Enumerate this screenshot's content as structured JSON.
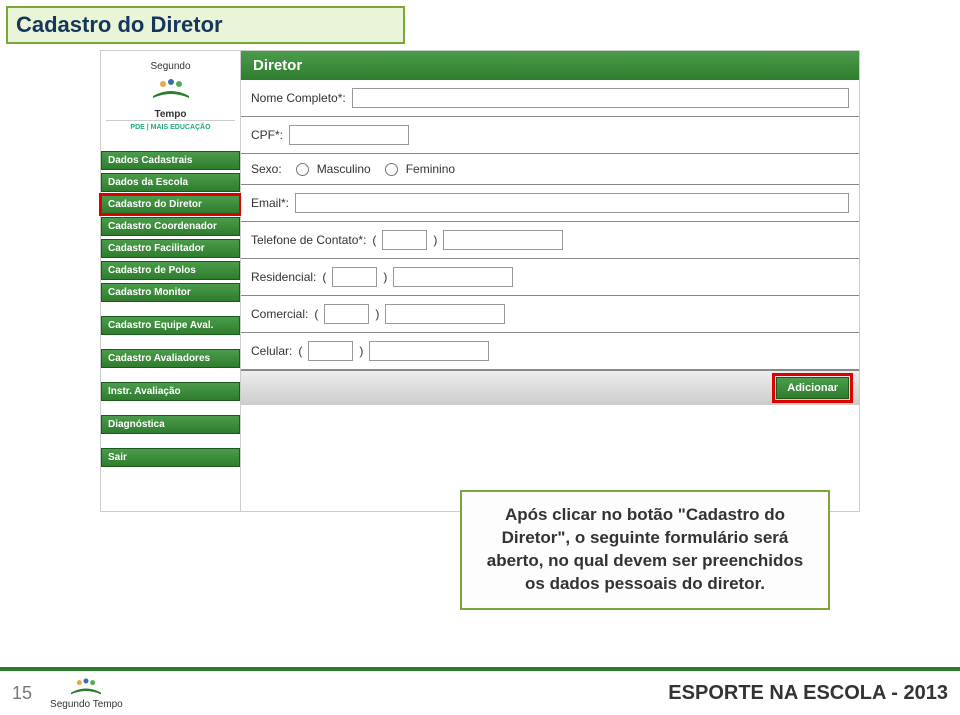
{
  "slide": {
    "title": "Cadastro do Diretor",
    "page_number": "15",
    "footer_right": "ESPORTE NA ESCOLA - 2013"
  },
  "sidebar": {
    "logo_title": "Segundo",
    "logo_title2": "Tempo",
    "logo_sub": "PDE | MAIS EDUCAÇÃO",
    "groups": [
      {
        "items": [
          {
            "label": "Dados Cadastrais",
            "selected": false
          },
          {
            "label": "Dados da Escola",
            "selected": false
          },
          {
            "label": "Cadastro do Diretor",
            "selected": true
          },
          {
            "label": "Cadastro Coordenador",
            "selected": false
          },
          {
            "label": "Cadastro Facilitador",
            "selected": false
          },
          {
            "label": "Cadastro de Polos",
            "selected": false
          },
          {
            "label": "Cadastro Monitor",
            "selected": false
          }
        ]
      },
      {
        "items": [
          {
            "label": "Cadastro Equipe Aval.",
            "selected": false
          }
        ]
      },
      {
        "items": [
          {
            "label": "Cadastro Avaliadores",
            "selected": false
          }
        ]
      },
      {
        "items": [
          {
            "label": "Instr. Avaliação",
            "selected": false
          }
        ]
      },
      {
        "items": [
          {
            "label": "Diagnóstica",
            "selected": false
          }
        ]
      },
      {
        "items": [
          {
            "label": "Sair",
            "selected": false
          }
        ]
      }
    ]
  },
  "form": {
    "title": "Diretor",
    "fields": {
      "nome_label": "Nome Completo*:",
      "cpf_label": "CPF*:",
      "sexo_label": "Sexo:",
      "sexo_m": "Masculino",
      "sexo_f": "Feminino",
      "email_label": "Email*:",
      "tel_label": "Telefone de Contato*:",
      "res_label": "Residencial:",
      "com_label": "Comercial:",
      "cel_label": "Celular:",
      "paren_open": "(",
      "paren_close": ")"
    },
    "add_button": "Adicionar"
  },
  "callout": {
    "text": "Após clicar no botão \"Cadastro do Diretor\", o seguinte formulário será aberto, no qual devem ser preenchidos os dados pessoais do diretor."
  }
}
